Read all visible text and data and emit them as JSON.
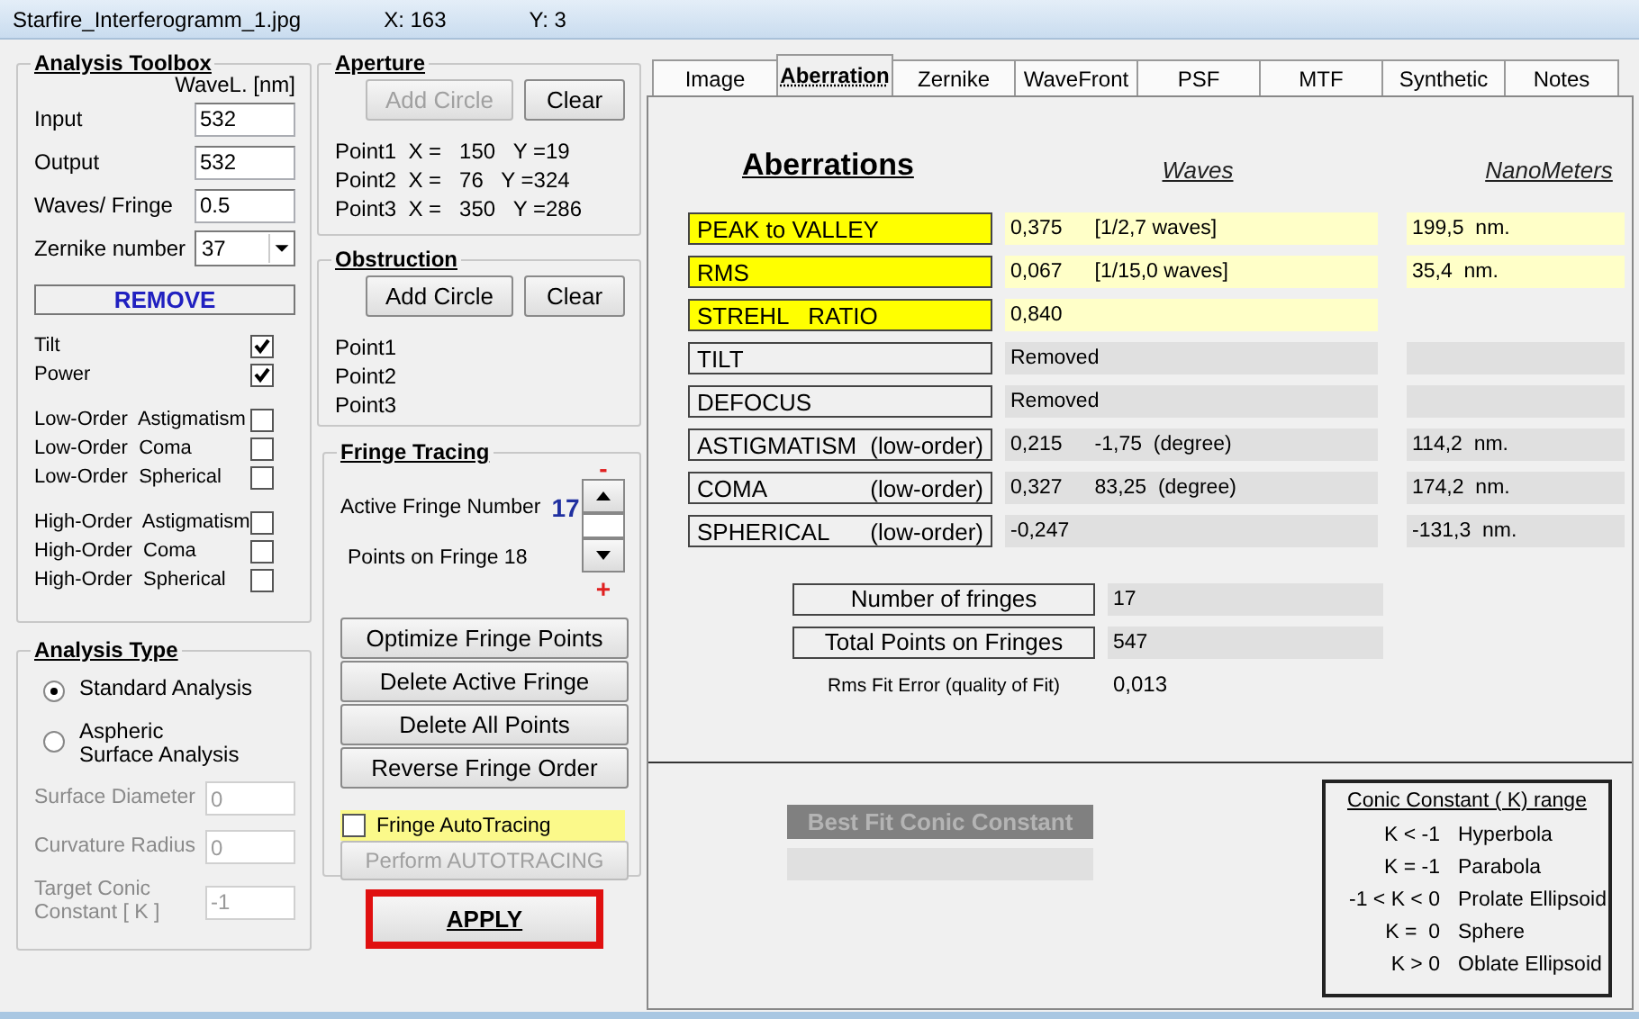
{
  "title_bar": {
    "filename": "Starfire_Interferogramm_1.jpg",
    "x": "X: 163",
    "y": "Y: 3"
  },
  "analysis_toolbox": {
    "title": "Analysis Toolbox",
    "column_header": "WaveL. [nm]",
    "fields": [
      {
        "kind": "text",
        "label": "Input",
        "value": "532"
      },
      {
        "kind": "text",
        "label": "Output",
        "value": "532"
      },
      {
        "kind": "text",
        "label": "Waves/ Fringe",
        "value": "0.5"
      },
      {
        "kind": "select",
        "label": "Zernike number",
        "value": "37"
      }
    ],
    "remove_header": "REMOVE",
    "checkbox_groups": [
      [
        {
          "label": "Tilt",
          "checked": true
        },
        {
          "label": "Power",
          "checked": true
        }
      ],
      [
        {
          "label": "Low-Order  Astigmatism",
          "checked": false
        },
        {
          "label": "Low-Order  Coma",
          "checked": false
        },
        {
          "label": "Low-Order  Spherical",
          "checked": false
        }
      ],
      [
        {
          "label": "High-Order  Astigmatism",
          "checked": false
        },
        {
          "label": "High-Order  Coma",
          "checked": false
        },
        {
          "label": "High-Order  Spherical",
          "checked": false
        }
      ]
    ]
  },
  "analysis_type": {
    "title": "Analysis Type",
    "options": [
      {
        "label": "Standard  Analysis",
        "selected": true
      },
      {
        "label": "Aspheric  Surface Analysis",
        "selected": false
      }
    ],
    "fields": [
      {
        "label": "Surface Diameter",
        "value": "0",
        "disabled": true
      },
      {
        "label": "Curvature Radius",
        "value": "0",
        "disabled": true
      },
      {
        "label": "Target Conic Constant [ K ]",
        "value": "-1",
        "disabled": true
      }
    ]
  },
  "aperture": {
    "title": "Aperture",
    "buttons": [
      {
        "label": "Add Circle",
        "disabled": true
      },
      {
        "label": "Clear",
        "disabled": false
      }
    ],
    "points": [
      "Point1  X =   150   Y =19",
      "Point2  X =   76   Y =324",
      "Point3  X =   350   Y =286"
    ]
  },
  "obstruction": {
    "title": "Obstruction",
    "buttons": [
      {
        "label": "Add Circle",
        "disabled": false
      },
      {
        "label": "Clear",
        "disabled": false
      }
    ],
    "points": [
      "Point1",
      "Point2",
      "Point3"
    ]
  },
  "fringe_tracing": {
    "title": "Fringe Tracing",
    "minus": "-",
    "plus": "+",
    "active_label": "Active Fringe Number",
    "active_value": "17",
    "points_label": "Points on  Fringe 18",
    "buttons": [
      "Optimize Fringe Points",
      "Delete Active Fringe",
      "Delete  All  Points",
      "Reverse  Fringe Order"
    ],
    "autotracing": {
      "label": "Fringe AutoTracing",
      "checked": false
    },
    "perform": {
      "label": "Perform  AUTOTRACING",
      "disabled": true
    }
  },
  "apply_button": "APPLY",
  "tabs": [
    {
      "label": "Image",
      "selected": false
    },
    {
      "label": "Aberration",
      "selected": true
    },
    {
      "label": "Zernike",
      "selected": false
    },
    {
      "label": "WaveFront",
      "selected": false
    },
    {
      "label": "PSF",
      "selected": false
    },
    {
      "label": "MTF",
      "selected": false
    },
    {
      "label": "Synthetic",
      "selected": false
    },
    {
      "label": "Notes",
      "selected": false
    }
  ],
  "aberrations": {
    "title": "Aberrations",
    "waves_header": "Waves",
    "nm_header": "NanoMeters",
    "rows": [
      {
        "kind": "highlight",
        "name": "PEAK to VALLEY",
        "waves": "0,375",
        "detail": "[1/2,7 waves]",
        "nm": "199,5  nm."
      },
      {
        "kind": "highlight",
        "name": "RMS",
        "waves": "0,067",
        "detail": "[1/15,0 waves]",
        "nm": "35,4  nm."
      },
      {
        "kind": "highlight",
        "name": "STREHL   RATIO",
        "waves": "0,840"
      },
      {
        "kind": "normal",
        "name": "TILT",
        "waves": "Removed",
        "nm_field": true
      },
      {
        "kind": "normal",
        "name": "DEFOCUS",
        "waves": "Removed",
        "nm_field": true
      },
      {
        "kind": "normal",
        "name": "ASTIGMATISM",
        "qualifier": "(low-order)",
        "waves": "0,215",
        "detail": "-1,75  (degree)",
        "nm": "114,2  nm."
      },
      {
        "kind": "normal",
        "name": "COMA",
        "qualifier": "(low-order)",
        "waves": "0,327",
        "detail": "83,25  (degree)",
        "nm": "174,2  nm."
      },
      {
        "kind": "normal",
        "name": "SPHERICAL",
        "qualifier": "(low-order)",
        "waves": "-0,247",
        "nm": "-131,3  nm."
      }
    ]
  },
  "fringe_summary": [
    {
      "kind": "boxed",
      "label": "Number of fringes",
      "value": "17"
    },
    {
      "kind": "boxed",
      "label": "Total  Points on Fringes",
      "value": "547"
    },
    {
      "kind": "plain",
      "label": "Rms Fit Error (quality of Fit)",
      "value": "0,013"
    }
  ],
  "best_fit": {
    "label": "Best Fit Conic Constant",
    "disabled": true
  },
  "conic_legend": {
    "title": "Conic Constant ( K)  range",
    "rows": [
      {
        "condition": "K < -1",
        "shape": "Hyperbola"
      },
      {
        "condition": "K = -1",
        "shape": "Parabola"
      },
      {
        "condition": "-1 < K < 0",
        "shape": "Prolate Ellipsoid"
      },
      {
        "condition": "K =  0",
        "shape": "Sphere"
      },
      {
        "condition": "K > 0",
        "shape": "Oblate Ellipsoid"
      }
    ]
  }
}
